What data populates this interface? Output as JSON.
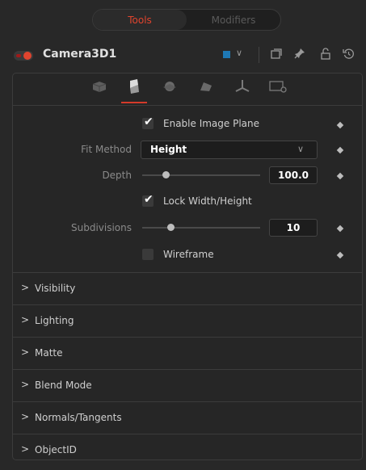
{
  "top_tabs": [
    {
      "label": "Tools",
      "active": true,
      "color": "#e0442e"
    },
    {
      "label": "Modifiers",
      "active": false,
      "color": "#5a5a5a"
    }
  ],
  "header": {
    "node_name": "Camera3D1",
    "enabled_color": "#e0442e",
    "swatch_color": "#1e78b4",
    "icons": [
      "color-chevron-icon",
      "window-icon",
      "pin-icon",
      "lock-icon",
      "reset-icon"
    ]
  },
  "subtabs": [
    {
      "icon": "camera-controls-icon",
      "active": false
    },
    {
      "icon": "image-plane-icon",
      "active": true
    },
    {
      "icon": "sphere-icon",
      "active": false
    },
    {
      "icon": "material-icon",
      "active": false
    },
    {
      "icon": "transform-icon",
      "active": false
    },
    {
      "icon": "settings-icon",
      "active": false
    }
  ],
  "controls": {
    "enable_image_plane": {
      "label": "Enable Image Plane",
      "checked": true
    },
    "fit_method": {
      "label": "Fit Method",
      "value": "Height"
    },
    "depth": {
      "label": "Depth",
      "value": "100.0"
    },
    "lock_wh": {
      "label": "Lock Width/Height",
      "checked": true
    },
    "subdivisions": {
      "label": "Subdivisions",
      "value": "10"
    },
    "wireframe": {
      "label": "Wireframe",
      "checked": false
    }
  },
  "sections": [
    {
      "label": "Visibility"
    },
    {
      "label": "Lighting"
    },
    {
      "label": "Matte"
    },
    {
      "label": "Blend Mode"
    },
    {
      "label": "Normals/Tangents"
    },
    {
      "label": "ObjectID"
    }
  ]
}
